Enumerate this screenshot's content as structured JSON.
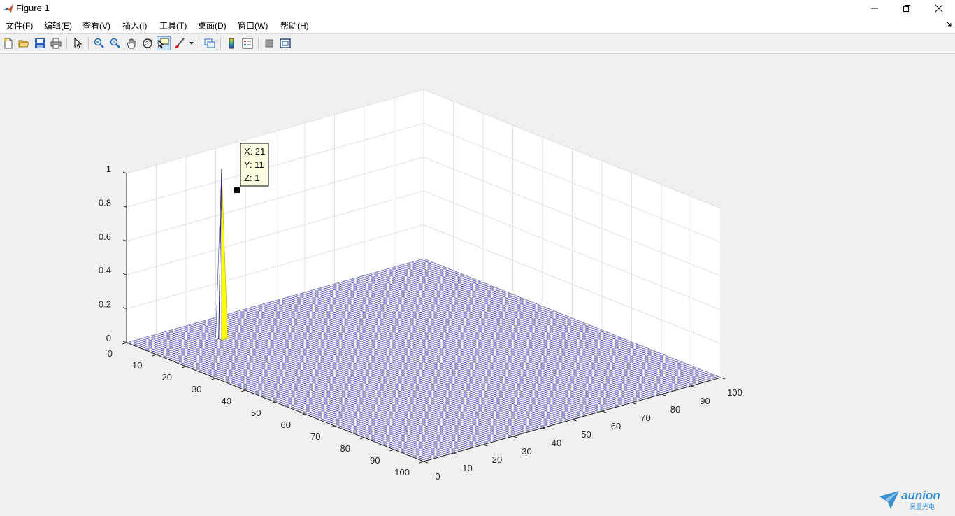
{
  "window": {
    "title": "Figure 1",
    "minimize_icon": "minimize-icon",
    "restore_icon": "restore-icon",
    "close_icon": "close-icon"
  },
  "menu": {
    "items": [
      "文件(F)",
      "编辑(E)",
      "查看(V)",
      "插入(I)",
      "工具(T)",
      "桌面(D)",
      "窗口(W)",
      "帮助(H)"
    ]
  },
  "toolbar": {
    "buttons": [
      "new-figure-icon",
      "open-file-icon",
      "save-icon",
      "print-icon",
      "edit-plot-pointer-icon",
      "zoom-in-icon",
      "zoom-out-icon",
      "pan-hand-icon",
      "rotate-3d-icon",
      "data-cursor-icon",
      "brush-icon",
      "link-plot-icon",
      "colorbar-icon",
      "legend-icon",
      "hide-plot-tools-icon",
      "show-plot-tools-icon"
    ],
    "active": "data-cursor-icon"
  },
  "chart_data": {
    "type": "surface",
    "z_ticks": [
      "0",
      "0.2",
      "0.4",
      "0.6",
      "0.8",
      "1"
    ],
    "x_ticks": [
      "0",
      "10",
      "20",
      "30",
      "40",
      "50",
      "60",
      "70",
      "80",
      "90",
      "100"
    ],
    "y_ticks": [
      "0",
      "10",
      "20",
      "30",
      "40",
      "50",
      "60",
      "70",
      "80",
      "90",
      "100"
    ],
    "zlim": [
      0,
      1
    ],
    "xlim": [
      0,
      100
    ],
    "ylim": [
      0,
      100
    ],
    "peak": {
      "x": 21,
      "y": 11,
      "z": 1
    },
    "surface_color": "#3a3aa8",
    "peak_color": "#ffff00",
    "grid": true
  },
  "datatip": {
    "x": "X: 21",
    "y": "Y: 11",
    "z": "Z: 1"
  },
  "watermark": {
    "name": "aunion",
    "subtitle": "昊量光电"
  }
}
